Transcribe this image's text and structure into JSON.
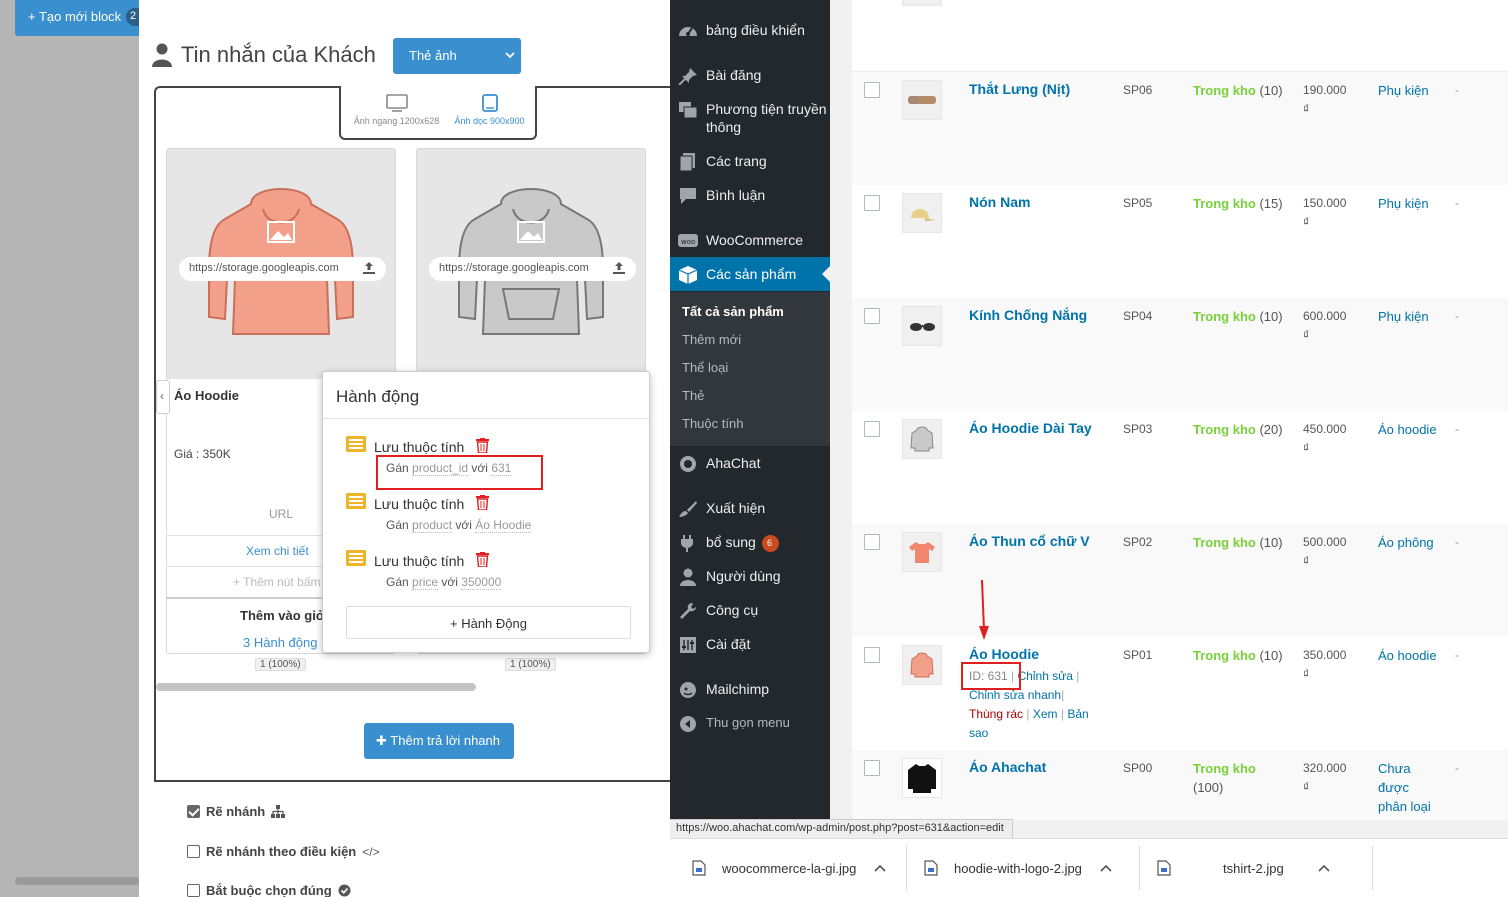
{
  "builder": {
    "new_block_label": "+ Tạo mới block",
    "block_count": "2",
    "title": "Tin nhắn của Khách",
    "card_type_selected": "Thẻ ảnh",
    "orientation": {
      "horizontal": "Ảnh ngang 1200x628",
      "vertical": "Ảnh dọc 900x900"
    },
    "cards": [
      {
        "image_url": "https://storage.googleapis.com",
        "image_color": "#f2a08a",
        "title": "Áo Hoodie",
        "price": "Giá : 350K",
        "url_label": "URL",
        "view_detail": "Xem chi tiết",
        "add_button": "+ Thêm nút bấm",
        "add_to_cart": "Thêm vào giỏ",
        "actions_link": "3 Hành động",
        "percent": "1 (100%)"
      },
      {
        "image_url": "https://storage.googleapis.com",
        "image_color": "#c9c9c9",
        "percent": "1 (100%)"
      }
    ],
    "add_quick_reply": "Thêm trả lời nhanh",
    "options": [
      {
        "label": "Rẽ nhánh",
        "checked": true,
        "icon": "sitemap-icon"
      },
      {
        "label": "Rẽ nhánh theo điều kiện",
        "checked": false,
        "icon": "code-icon"
      },
      {
        "label": "Bắt buộc chọn đúng",
        "checked": false,
        "icon": "check-circle-icon"
      }
    ]
  },
  "action_popup": {
    "title": "Hành động",
    "items": [
      {
        "title": "Lưu thuộc tính",
        "verb": "Gán",
        "attr": "product_id",
        "with": "với",
        "value": "631"
      },
      {
        "title": "Lưu thuộc tính",
        "verb": "Gán",
        "attr": "product",
        "with": "với",
        "value": "Áo Hoodie"
      },
      {
        "title": "Lưu thuộc tính",
        "verb": "Gán",
        "attr": "price",
        "with": "với",
        "value": "350000"
      }
    ],
    "add_action": "+ Hành Động"
  },
  "wp_menu": {
    "items": [
      {
        "label": "bảng điều khiển",
        "icon": "dashboard-icon"
      },
      {
        "label": "Bài đăng",
        "icon": "pin-icon"
      },
      {
        "label": "Phương tiện truyền thông",
        "icon": "media-icon"
      },
      {
        "label": "Các trang",
        "icon": "pages-icon"
      },
      {
        "label": "Bình luận",
        "icon": "comment-icon"
      },
      {
        "label": "WooCommerce",
        "icon": "woo-icon"
      },
      {
        "label": "Các sản phẩm",
        "icon": "product-box-icon"
      },
      {
        "label": "AhaChat",
        "icon": "ahachat-icon"
      },
      {
        "label": "Xuất hiện",
        "icon": "brush-icon"
      },
      {
        "label": "bổ sung",
        "icon": "plugin-icon",
        "badge": "6"
      },
      {
        "label": "Người dùng",
        "icon": "user-icon"
      },
      {
        "label": "Công cụ",
        "icon": "wrench-icon"
      },
      {
        "label": "Cài đặt",
        "icon": "settings-icon"
      },
      {
        "label": "Mailchimp",
        "icon": "mailchimp-icon"
      },
      {
        "label": "Thu gọn menu",
        "icon": "collapse-icon"
      }
    ],
    "submenu": [
      "Tất cả sản phẩm",
      "Thêm mới",
      "Thể loại",
      "Thẻ",
      "Thuộc tính"
    ]
  },
  "products": [
    {
      "name": "Thắt Lưng (Nịt)",
      "sku": "SP06",
      "stock": "Trong kho",
      "qty": "(10)",
      "price": "190.000",
      "currency": "₫",
      "category": "Phụ kiện",
      "dash": "-"
    },
    {
      "name": "Nón Nam",
      "sku": "SP05",
      "stock": "Trong kho",
      "qty": "(15)",
      "price": "150.000",
      "currency": "₫",
      "category": "Phụ kiện",
      "dash": "-"
    },
    {
      "name": "Kính Chống Nắng",
      "sku": "SP04",
      "stock": "Trong kho",
      "qty": "(10)",
      "price": "600.000",
      "currency": "₫",
      "category": "Phụ kiện",
      "dash": "-"
    },
    {
      "name": "Áo Hoodie Dài Tay",
      "sku": "SP03",
      "stock": "Trong kho",
      "qty": "(20)",
      "price": "450.000",
      "currency": "₫",
      "category": "Áo hoodie",
      "dash": "-"
    },
    {
      "name": "Áo Thun cổ chữ V",
      "sku": "SP02",
      "stock": "Trong kho",
      "qty": "(10)",
      "price": "500.000",
      "currency": "₫",
      "category": "Áo phông",
      "dash": "-"
    },
    {
      "name": "Áo Hoodie",
      "sku": "SP01",
      "stock": "Trong kho",
      "qty": "(10)",
      "price": "350.000",
      "currency": "₫",
      "category": "Áo hoodie",
      "dash": "-"
    },
    {
      "name": "Áo Ahachat",
      "sku": "SP00",
      "stock": "Trong kho",
      "qty": "(100)",
      "price": "320.000",
      "currency": "₫",
      "category": "Chưa được phân loại",
      "dash": "-"
    }
  ],
  "row_actions": {
    "id": "ID: 631",
    "edit": "Chỉnh sửa",
    "quick_edit": "Chỉnh sửa nhanh",
    "trash": "Thùng rác",
    "view": "Xem",
    "duplicate": "Bản sao"
  },
  "status_url": "https://woo.ahachat.com/wp-admin/post.php?post=631&action=edit",
  "downloads": [
    {
      "name": "woocommerce-la-gi.jpg"
    },
    {
      "name": "hoodie-with-logo-2.jpg"
    },
    {
      "name": "tshirt-2.jpg"
    }
  ]
}
